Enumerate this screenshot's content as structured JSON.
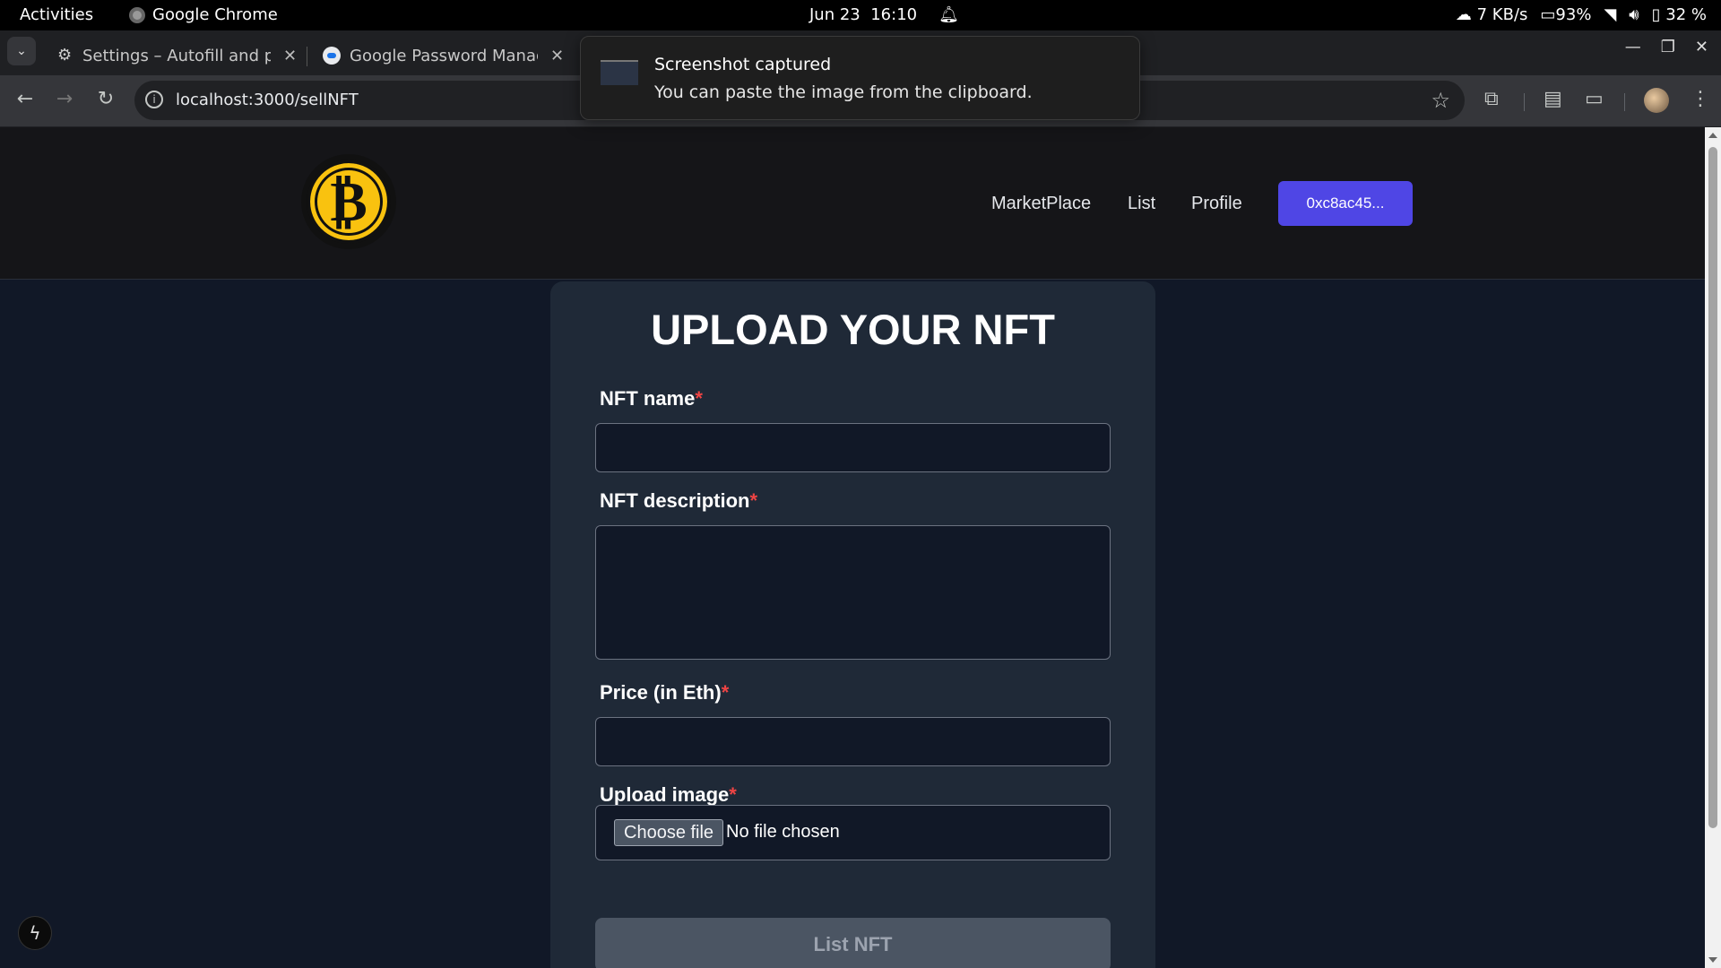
{
  "system_bar": {
    "activities": "Activities",
    "app_name": "Google Chrome",
    "date": "Jun 23",
    "time": "16:10",
    "network_speed": "7 KB/s",
    "battery_device": "93%",
    "battery_phone": "32 %"
  },
  "browser": {
    "tabs": [
      {
        "title": "Settings – Autofill and passwords",
        "icon": "gear-icon"
      },
      {
        "title": "Google Password Manager",
        "icon": "password-manager-icon"
      }
    ],
    "url": "localhost:3000/sellNFT"
  },
  "notification": {
    "title": "Screenshot captured",
    "body": "You can paste the image from the clipboard."
  },
  "site": {
    "nav": {
      "marketplace": "MarketPlace",
      "list": "List",
      "profile": "Profile",
      "wallet": "0xc8ac45..."
    },
    "form": {
      "title": "UPLOAD YOUR NFT",
      "name_label": "NFT name",
      "description_label": "NFT description",
      "price_label": "Price (in Eth)",
      "image_label": "Upload image",
      "required_mark": "*",
      "choose_file": "Choose file",
      "no_file": "No file chosen",
      "submit": "List NFT"
    }
  },
  "colors": {
    "accent": "#4f46e5",
    "required": "#ef4444",
    "logo": "#f9c20f"
  }
}
